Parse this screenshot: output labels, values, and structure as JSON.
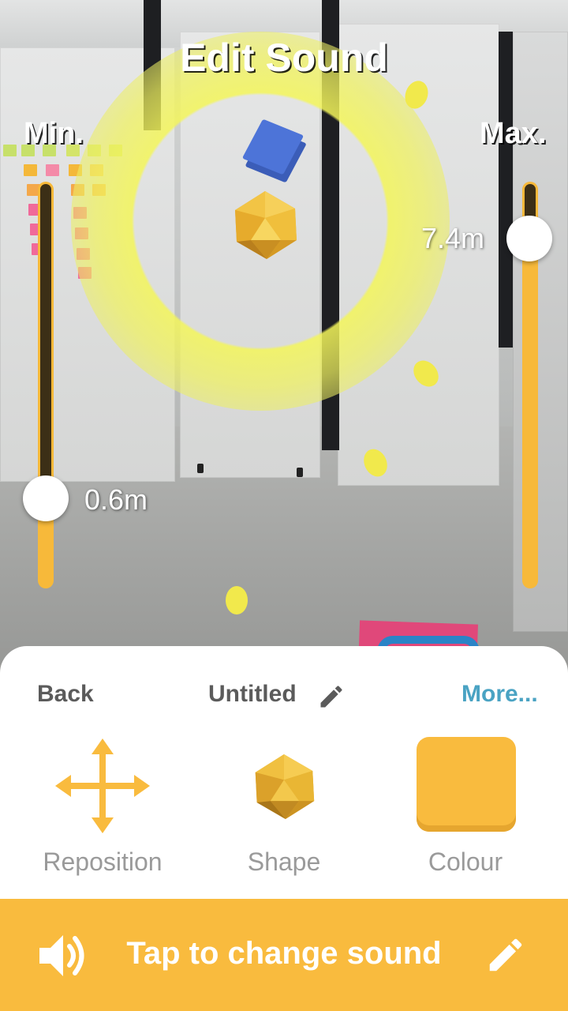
{
  "header": {
    "title": "Edit Sound",
    "min_label": "Min.",
    "max_label": "Max."
  },
  "range": {
    "min_value": "0.6m",
    "max_value": "7.4m",
    "min_knob_fraction": 0.22,
    "max_knob_fraction": 0.87
  },
  "sheet": {
    "back_label": "Back",
    "sound_name": "Untitled",
    "more_label": "More...",
    "tools": [
      {
        "label": "Reposition",
        "icon": "move-arrows-icon"
      },
      {
        "label": "Shape",
        "icon": "icosahedron-icon"
      },
      {
        "label": "Colour",
        "icon": "colour-swatch"
      }
    ],
    "swatch_color": "#f9bb3e"
  },
  "bottom_bar": {
    "label": "Tap to change sound",
    "icon_left": "speaker-icon",
    "icon_right": "pencil-icon"
  },
  "colors": {
    "accent": "#f9bb3e",
    "link": "#4aa3c3",
    "label_gray": "#9a9a9a"
  }
}
